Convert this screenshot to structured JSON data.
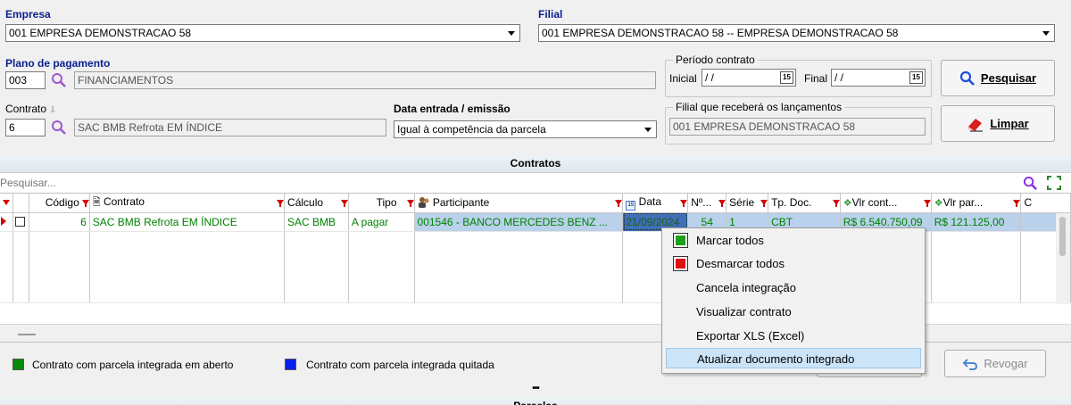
{
  "empresa": {
    "label": "Empresa",
    "value": "001 EMPRESA DEMONSTRACAO 58"
  },
  "filial": {
    "label": "Filial",
    "value": "001 EMPRESA DEMONSTRACAO 58 -- EMPRESA DEMONSTRACAO 58"
  },
  "plano": {
    "label": "Plano de pagamento",
    "code": "003",
    "description": "FINANCIAMENTOS"
  },
  "periodo": {
    "title": "Período contrato",
    "inicial_label": "Inicial",
    "inicial_value": "/ /",
    "final_label": "Final",
    "final_value": "/ /",
    "calendar_glyph": "15"
  },
  "contrato": {
    "label": "Contrato",
    "code": "6",
    "description": "SAC BMB Refrota EM ÍNDICE"
  },
  "data_entrada": {
    "label": "Data entrada / emissão",
    "value": "Igual à competência da parcela"
  },
  "filial_lanc": {
    "title": "Filial que receberá os lançamentos",
    "value": "001 EMPRESA DEMONSTRACAO 58"
  },
  "buttons": {
    "pesquisar": "Pesquisar",
    "limpar": "Limpar",
    "revogar": "Revogar"
  },
  "section": {
    "contratos": "Contratos",
    "bottom": "Parcelas",
    "dots": "•••"
  },
  "search": {
    "placeholder": "Pesquisar..."
  },
  "grid": {
    "headers": [
      "Código",
      "Contrato",
      "Cálculo",
      "Tipo",
      "Participante",
      "Data",
      "Nº...",
      "Série",
      "Tp. Doc.",
      "Vlr cont...",
      "Vlr par...",
      "C"
    ],
    "rows": [
      {
        "codigo": "6",
        "contrato": "SAC BMB Refrota EM ÍNDICE",
        "calculo": "SAC BMB",
        "tipo": "A pagar",
        "participante": "001546 - BANCO MERCEDES BENZ ...",
        "data": "21/09/2024",
        "numero": "54",
        "serie": "1",
        "tpdoc": "CBT",
        "vlr_cont": "R$ 6.540.750,09",
        "vlr_par": "R$ 121.125,00"
      }
    ]
  },
  "context_menu": {
    "items": [
      "Marcar todos",
      "Desmarcar todos",
      "Cancela integração",
      "Visualizar contrato",
      "Exportar XLS (Excel)",
      "Atualizar documento integrado"
    ]
  },
  "legend": {
    "aberto": "Contrato com parcela integrada em aberto",
    "quitada": "Contrato com parcela integrada quitada"
  },
  "colors": {
    "title_blue": "#0b1f8c",
    "green": "#008000",
    "selected_bg": "#b9d1ea",
    "filter_red": "#d40000",
    "search_purple": "#8a2be2"
  }
}
